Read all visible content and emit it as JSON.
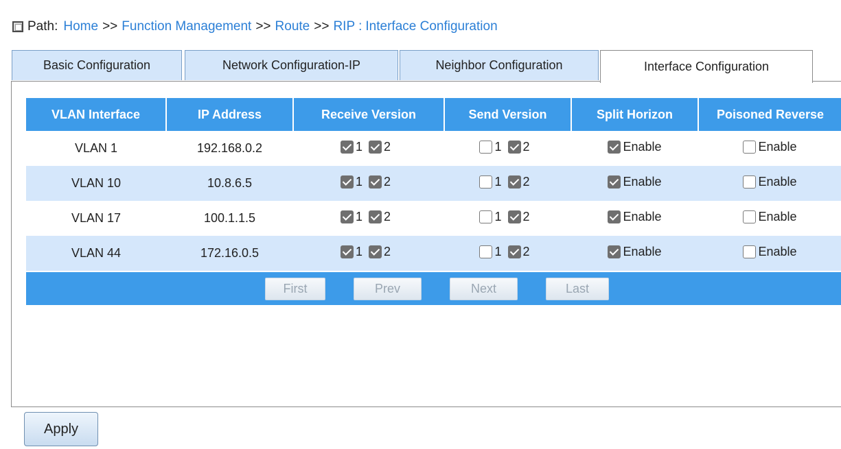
{
  "breadcrumb": {
    "prefix": "Path:",
    "items": [
      "Home",
      "Function Management",
      "Route",
      "RIP"
    ],
    "separator": ">>",
    "current": "Interface Configuration",
    "colon": ":"
  },
  "tabs": [
    {
      "label": "Basic Configuration",
      "active": false
    },
    {
      "label": "Network Configuration-IP",
      "active": false
    },
    {
      "label": "Neighbor Configuration",
      "active": false
    },
    {
      "label": "Interface Configuration",
      "active": true
    }
  ],
  "table": {
    "headers": [
      "VLAN Interface",
      "IP Address",
      "Receive Version",
      "Send Version",
      "Split Horizon",
      "Poisoned Reverse"
    ],
    "rows": [
      {
        "vlan": "VLAN 1",
        "ip": "192.168.0.2",
        "recv_v1": true,
        "recv_v2": true,
        "send_v1": false,
        "send_v2": true,
        "split_horizon": true,
        "poisoned_reverse": false
      },
      {
        "vlan": "VLAN 10",
        "ip": "10.8.6.5",
        "recv_v1": true,
        "recv_v2": true,
        "send_v1": false,
        "send_v2": true,
        "split_horizon": true,
        "poisoned_reverse": false
      },
      {
        "vlan": "VLAN 17",
        "ip": "100.1.1.5",
        "recv_v1": true,
        "recv_v2": true,
        "send_v1": false,
        "send_v2": true,
        "split_horizon": true,
        "poisoned_reverse": false
      },
      {
        "vlan": "VLAN 44",
        "ip": "172.16.0.5",
        "recv_v1": true,
        "recv_v2": true,
        "send_v1": false,
        "send_v2": true,
        "split_horizon": true,
        "poisoned_reverse": false
      }
    ],
    "version_labels": [
      "1",
      "2"
    ],
    "enable_label": "Enable"
  },
  "pager": {
    "first": "First",
    "prev": "Prev",
    "next": "Next",
    "last": "Last"
  },
  "apply_label": "Apply",
  "colors": {
    "header_blue": "#3d9be9",
    "row_alt": "#d5e7fb",
    "link_blue": "#2b7fd6",
    "tab_inactive": "#d4e6fa"
  }
}
